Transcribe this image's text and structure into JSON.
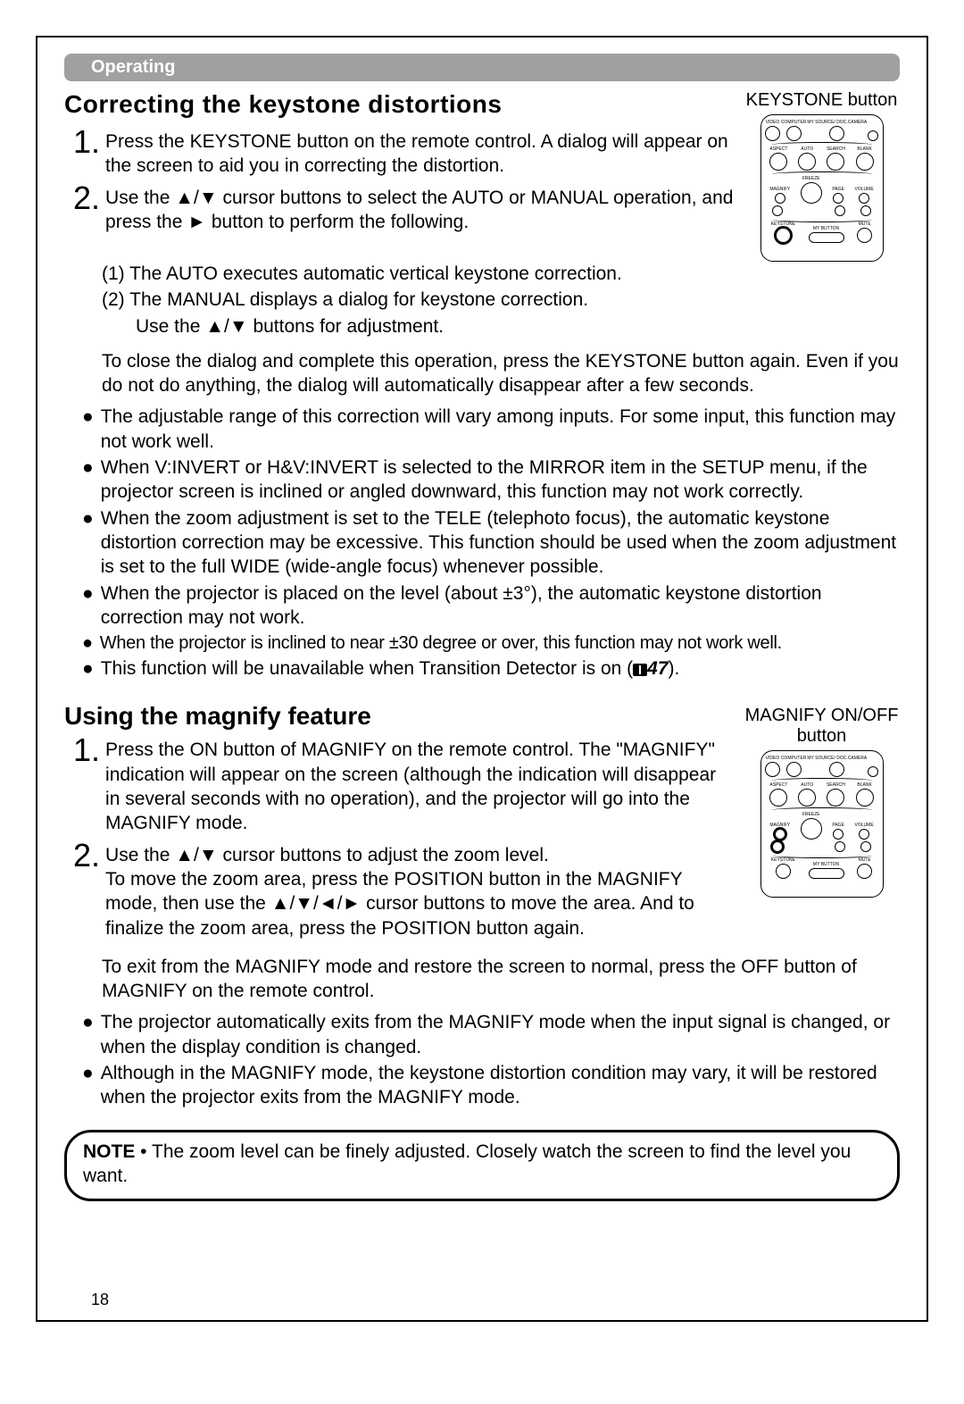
{
  "section_header": "Operating",
  "keystone": {
    "heading": "Correcting the keystone distortions",
    "remote_label": "KEYSTONE button",
    "step1": "Press the KEYSTONE button on the remote control. A dialog will appear on the screen to aid you in correcting the distortion.",
    "step2": "Use the ▲/▼ cursor buttons to select the AUTO or MANUAL operation, and press the ► button to perform the following.",
    "sub1": "(1)  The AUTO executes automatic vertical keystone correction.",
    "sub2_line1": "(2)  The MANUAL displays a dialog for keystone correction.",
    "sub2_line2": "Use the ▲/▼ buttons for adjustment.",
    "close_para": "To close the dialog and complete this operation, press the KEYSTONE button again. Even if you do not do anything, the dialog will automatically disappear after a few seconds.",
    "bullets": [
      "The adjustable range of this correction will vary among inputs. For some input, this function may not work well.",
      "When V:INVERT or H&V:INVERT is selected to the MIRROR item in the SETUP menu, if the projector screen is inclined or angled downward, this function may not work correctly.",
      "When the zoom adjustment is set to the TELE (telephoto focus), the automatic keystone distortion correction may be excessive. This function should be used when the zoom adjustment is set to the full WIDE (wide-angle focus) whenever possible.",
      "When the projector is placed on the level (about ±3°), the automatic keystone distortion correction may not work.",
      "When the projector is inclined to near ±30 degree or over, this function may not work well."
    ],
    "bullet_ref_prefix": "This function will be unavailable when Transition Detector is on (",
    "bullet_ref_page": "47",
    "bullet_ref_suffix": ")."
  },
  "magnify": {
    "heading": "Using the magnify feature",
    "remote_label": "MAGNIFY ON/OFF button",
    "step1": "Press the ON button of MAGNIFY on the remote control. The \"MAGNIFY\" indication will appear on the screen (although the indication will disappear in several seconds with no operation), and the projector will go into the MAGNIFY mode.",
    "step2_line1": "Use the ▲/▼ cursor buttons to adjust the zoom level.",
    "step2_rest": "To move the zoom area, press the POSITION button in the MAGNIFY mode, then use the ▲/▼/◄/► cursor buttons to move the area. And to finalize the zoom area, press the POSITION button again.",
    "exit_para": "To exit from the MAGNIFY mode and restore the screen to normal, press the OFF button of MAGNIFY on the remote control.",
    "bullets": [
      "The projector automatically exits from the MAGNIFY mode when the input signal is changed, or when the display condition is changed.",
      "Although in the MAGNIFY mode, the keystone distortion condition may vary, it will be restored when the projector exits from the MAGNIFY mode."
    ]
  },
  "note": {
    "label": "NOTE",
    "text": " • The zoom level can be finely adjusted. Closely watch the screen to find the level you want."
  },
  "page_number": "18",
  "remote_buttons": {
    "r1": [
      "VIDEO",
      "COMPUTER",
      "MY SOURCE/ DOC.CAMERA",
      ""
    ],
    "r2": [
      "ASPECT",
      "AUTO",
      "SEARCH",
      "BLANK"
    ],
    "r3_left": "MAGNIFY",
    "r3_center": "FREEZE",
    "r3_page": "PAGE",
    "r3_right": "VOLUME",
    "r5": [
      "KEYSTONE",
      "MY BUTTON",
      "MUTE"
    ]
  }
}
